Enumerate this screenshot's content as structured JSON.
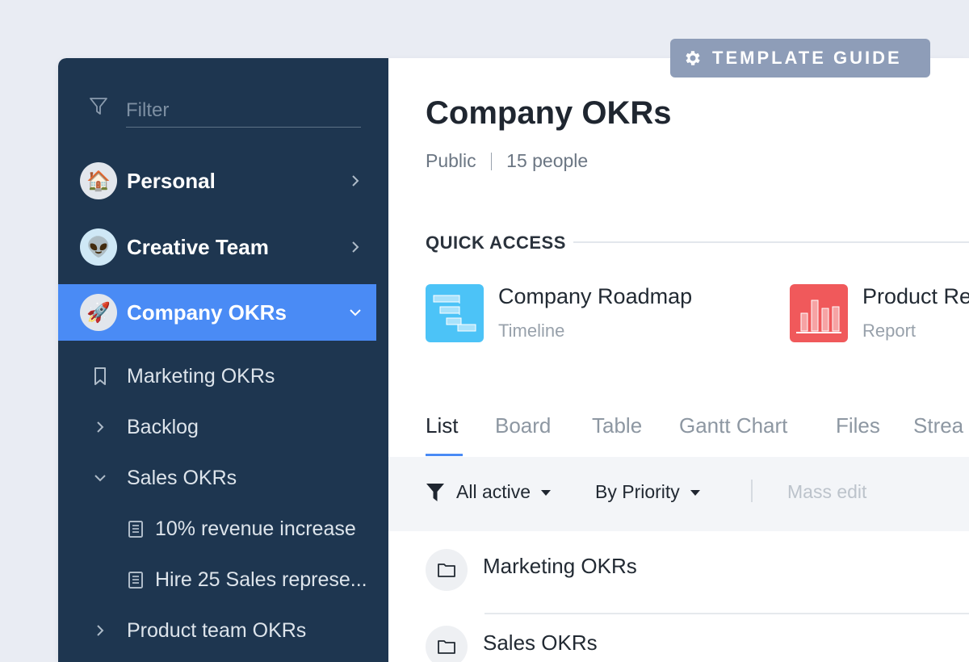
{
  "guide_badge": {
    "label": "TEMPLATE GUIDE",
    "icon": "gear-icon"
  },
  "sidebar": {
    "filter_placeholder": "Filter",
    "workspaces": [
      {
        "label": "Personal",
        "emoji": "🏠",
        "expanded": false
      },
      {
        "label": "Creative Team",
        "emoji": "👽",
        "expanded": false
      },
      {
        "label": "Company OKRs",
        "emoji": "🚀",
        "expanded": true
      }
    ],
    "tree": [
      {
        "label": "Marketing OKRs",
        "icon": "bookmark-icon"
      },
      {
        "label": "Backlog",
        "icon": "chevron-right-icon"
      },
      {
        "label": "Sales OKRs",
        "icon": "chevron-down-icon"
      },
      {
        "label": "10% revenue increase",
        "icon": "task-icon"
      },
      {
        "label": "Hire 25 Sales represe...",
        "icon": "task-icon"
      },
      {
        "label": "Product team OKRs",
        "icon": "chevron-right-icon"
      }
    ]
  },
  "main": {
    "title": "Company OKRs",
    "visibility": "Public",
    "people": "15 people",
    "quick_access": {
      "title": "QUICK ACCESS",
      "items": [
        {
          "name": "Company Roadmap",
          "type": "Timeline",
          "color": "#4cc3f7"
        },
        {
          "name": "Product  Releas",
          "type": "Report",
          "color": "#f0595b"
        }
      ]
    },
    "tabs": [
      "List",
      "Board",
      "Table",
      "Gantt Chart",
      "Files",
      "Strea"
    ],
    "toolbar": {
      "filter": "All active",
      "sort": "By Priority",
      "mass_edit": "Mass edit"
    },
    "folders": [
      "Marketing OKRs",
      "Sales OKRs"
    ]
  },
  "colors": {
    "sidebar_bg": "#1e3650",
    "active_blue": "#4a8bf5",
    "badge_bg": "#8e9db8"
  }
}
